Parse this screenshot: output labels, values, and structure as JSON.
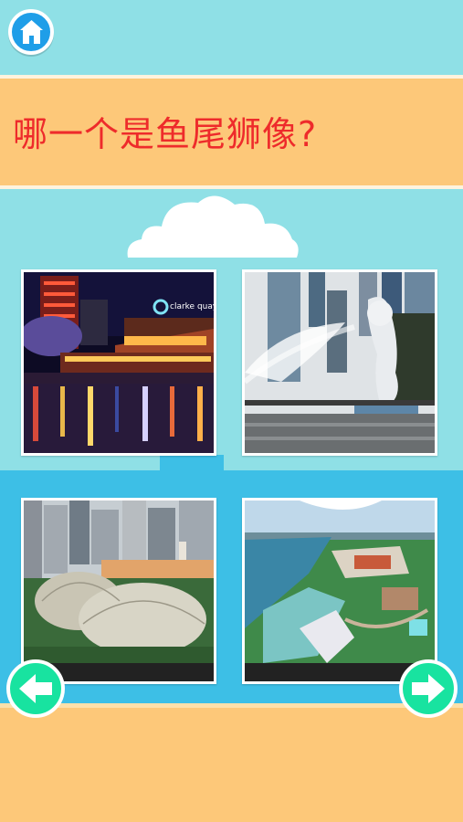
{
  "question": {
    "text": "哪一个是鱼尾狮像?"
  },
  "options": [
    {
      "id": "clarke-quay",
      "sign_text": "clarke quay"
    },
    {
      "id": "merlion"
    },
    {
      "id": "esplanade"
    },
    {
      "id": "sentosa"
    }
  ],
  "colors": {
    "sky": "#8fe0e6",
    "title_bar": "#fdc879",
    "title_text": "#ee2b2b",
    "city_silhouette": "#3dbfe6",
    "nav_button": "#18e3a0",
    "home_button": "#1f9ee8"
  },
  "icons": {
    "home": "home-icon",
    "prev": "arrow-left-icon",
    "next": "arrow-right-icon"
  }
}
